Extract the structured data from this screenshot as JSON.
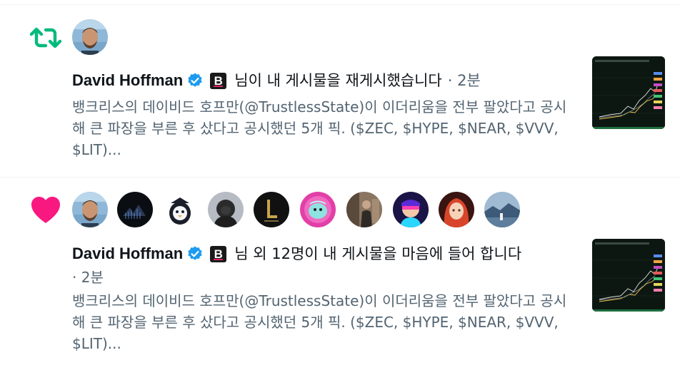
{
  "notifications": [
    {
      "kind": "repost",
      "icon": "repost-icon",
      "user_name": "David Hoffman",
      "action_text": "님이 내 게시물을 재게시했습니다",
      "time_text": "· 2분",
      "post_text": "뱅크리스의 데이비드 호프만(@TrustlessState)이 이더리움을 전부 팔았다고 공시해 큰 파장을 부른 후 샀다고 공시했던 5개 픽. ($ZEC, $HYPE, $NEAR, $VVV, $LIT)...",
      "accent_color": "#00ba7c"
    },
    {
      "kind": "like",
      "icon": "heart-icon",
      "user_name": "David Hoffman",
      "action_text": "님 외 12명이 내 게시물을 마음에 들어 합니다",
      "time_text": "· 2분",
      "post_text": "뱅크리스의 데이비드 호프만(@TrustlessState)이 이더리움을 전부 팔았다고 공시해 큰 파장을 부른 후 샀다고 공시했던 5개 픽. ($ZEC, $HYPE, $NEAR, $VVV, $LIT)...",
      "accent_color": "#f91880",
      "liker_avatars": [
        "avatar-david-hoffman",
        "avatar-2",
        "avatar-3",
        "avatar-4",
        "avatar-5",
        "avatar-6",
        "avatar-7",
        "avatar-8",
        "avatar-9",
        "avatar-10"
      ]
    }
  ],
  "verified_color": "#1d9bf0"
}
